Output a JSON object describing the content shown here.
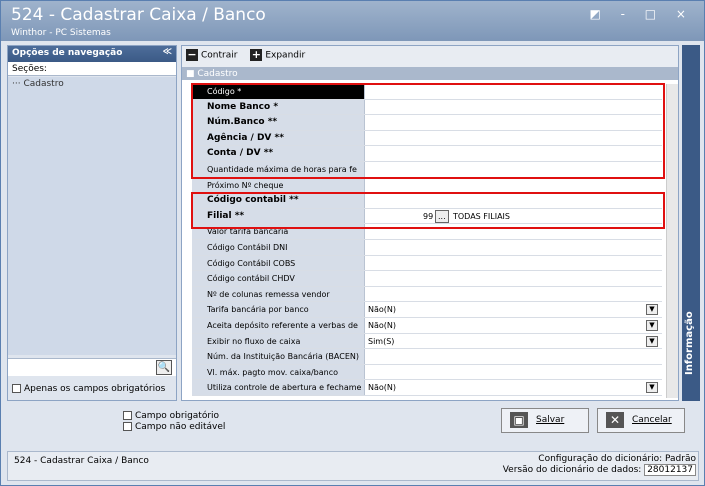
{
  "window": {
    "title": "524 - Cadastrar Caixa / Banco",
    "subtitle": "Winthor - PC Sistemas",
    "controls": "◩ - □ ×"
  },
  "nav": {
    "header": "Opções de navegação",
    "collapse": "≪",
    "sections_label": "Seções:",
    "tree_item": "··· Cadastro",
    "search_icon": "🔍",
    "only_required": "Apenas os campos obrigatórios"
  },
  "toolbar": {
    "collapse_label": "Contrair",
    "expand_label": "Expandir"
  },
  "group": {
    "label": "Cadastro"
  },
  "fields": [
    {
      "label": "Código *",
      "value": ""
    },
    {
      "label": "Nome Banco *",
      "value": ""
    },
    {
      "label": "Núm.Banco **",
      "value": ""
    },
    {
      "label": "Agência / DV **",
      "value": ""
    },
    {
      "label": "Conta / DV **",
      "value": ""
    },
    {
      "label": "Quantidade máxima de horas para fe",
      "value": ""
    },
    {
      "label": "Próximo Nº cheque",
      "value": ""
    },
    {
      "label": "Código contabil **",
      "value": ""
    },
    {
      "label": "Filial **",
      "value": "99",
      "button": "...",
      "extra": "TODAS FILIAIS"
    },
    {
      "label": "Valor tarifa bancária",
      "value": ""
    },
    {
      "label": "Código Contábil DNI",
      "value": ""
    },
    {
      "label": "Código Contábil COBS",
      "value": ""
    },
    {
      "label": "Código contábil CHDV",
      "value": ""
    },
    {
      "label": "Nº de colunas remessa vendor",
      "value": ""
    },
    {
      "label": "Tarifa bancária por banco",
      "value": "Não(N)"
    },
    {
      "label": "Aceita depósito referente a verbas de",
      "value": "Não(N)"
    },
    {
      "label": "Exibir no fluxo de caixa",
      "value": "Sim(S)"
    },
    {
      "label": "Núm. da Instituição Bancária (BACEN)",
      "value": ""
    },
    {
      "label": "Vl. máx. pagto mov. caixa/banco",
      "value": ""
    },
    {
      "label": "Utiliza controle de abertura e fechame",
      "value": "Não(N)"
    }
  ],
  "info_panel": {
    "label": "Informação"
  },
  "legend": {
    "required": "Campo obrigatório",
    "not_editable": "Campo não editável"
  },
  "buttons": {
    "save": "Salvar",
    "cancel": "Cancelar"
  },
  "status": {
    "left": "524 - Cadastrar Caixa / Banco",
    "config_label": "Configuração do dicionário:",
    "config_value": "Padrão",
    "version_label": "Versão do dicionário de dados:",
    "version_value": "28012137"
  }
}
